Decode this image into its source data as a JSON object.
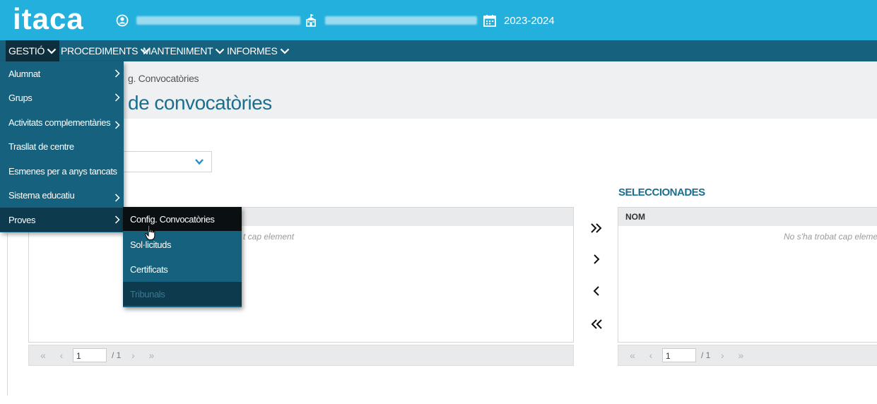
{
  "header": {
    "logo": "itaca",
    "year": "2023-2024",
    "colors": {
      "topbar": "#23b0dd",
      "navbar": "#16617d",
      "active": "#0d2e3c"
    }
  },
  "nav": {
    "items": [
      {
        "label": "GESTIÓ"
      },
      {
        "label": "PROCEDIMENTS"
      },
      {
        "label": "MANTENIMENT"
      },
      {
        "label": "INFORMES"
      }
    ]
  },
  "content": {
    "breadcrumb": "g. Convocatòries",
    "title": "de convocatòries",
    "selected_title": "SELECCIONADES",
    "left_empty": "t cap element",
    "right_header": "NOM",
    "right_empty": "No s'ha trobat cap eleme",
    "left_pager": {
      "page": "1",
      "total": "/ 1"
    },
    "right_pager": {
      "page": "1",
      "total": "/ 1"
    }
  },
  "menu": {
    "items": [
      {
        "label": "Alumnat"
      },
      {
        "label": "Grups"
      },
      {
        "label": "Activitats complementàries"
      },
      {
        "label": "Trasllat de centre"
      },
      {
        "label": "Esmenes per a anys tancats"
      },
      {
        "label": "Sistema educatiu"
      },
      {
        "label": "Proves"
      }
    ]
  },
  "submenu": {
    "items": [
      {
        "label": "Config. Convocatòries"
      },
      {
        "label": "Sol·licituds"
      },
      {
        "label": "Certificats"
      },
      {
        "label": "Tribunals"
      }
    ]
  }
}
